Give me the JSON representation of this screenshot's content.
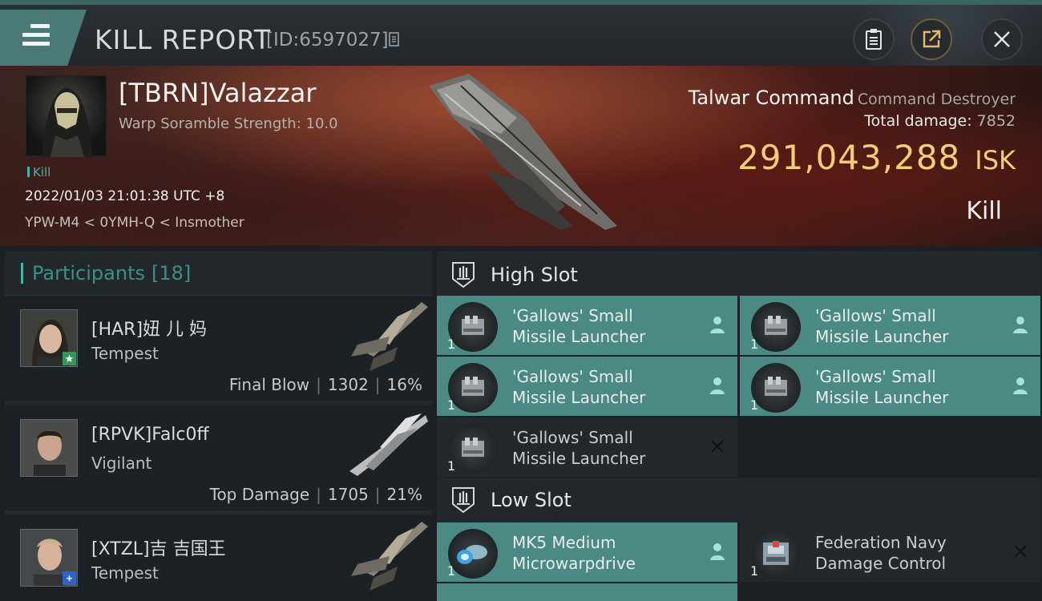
{
  "header": {
    "title": "KILL REPORT",
    "report_id": "[ID:6597027]"
  },
  "victim": {
    "name": "[TBRN]Valazzar",
    "scramble": "Warp Soramble Strength: 10.0",
    "tag": "Kill",
    "datetime": "2022/01/03 21:01:38 UTC +8",
    "location": "YPW-M4 < 0YMH-Q < Insmother",
    "ship_name": "Talwar Command",
    "ship_class": "Command Destroyer",
    "damage_label": "Total damage:",
    "damage_value": "7852",
    "isk_value": "291,043,288",
    "isk_unit": "ISK",
    "result": "Kill"
  },
  "participants": {
    "title": "Participants",
    "count": "[18]",
    "items": [
      {
        "name": "[HAR]妞 儿 妈",
        "ship": "Tempest",
        "role": "Final Blow",
        "damage": "1302",
        "pct": "16%",
        "badge": "★"
      },
      {
        "name": "[RPVK]Falc0ff",
        "ship": "Vigilant",
        "role": "Top Damage",
        "damage": "1705",
        "pct": "21%",
        "badge": ""
      },
      {
        "name": "[XTZL]吉 吉国王",
        "ship": "Tempest",
        "role": "",
        "damage": "",
        "pct": "",
        "badge": "+"
      }
    ]
  },
  "slots": {
    "high": {
      "title": "High Slot",
      "modules": [
        {
          "line1": "'Gallows' Small",
          "line2": "Missile Launcher",
          "qty": "1",
          "status": "dropped"
        },
        {
          "line1": "'Gallows' Small",
          "line2": "Missile Launcher",
          "qty": "1",
          "status": "dropped"
        },
        {
          "line1": "'Gallows' Small",
          "line2": "Missile Launcher",
          "qty": "1",
          "status": "dropped"
        },
        {
          "line1": "'Gallows' Small",
          "line2": "Missile Launcher",
          "qty": "1",
          "status": "dropped"
        },
        {
          "line1": "'Gallows' Small",
          "line2": "Missile Launcher",
          "qty": "1",
          "status": "destroyed"
        }
      ]
    },
    "low": {
      "title": "Low Slot",
      "modules": [
        {
          "line1": "MK5 Medium",
          "line2": "Microwarpdrive",
          "qty": "1",
          "status": "dropped"
        },
        {
          "line1": "Federation Navy",
          "line2": "Damage Control",
          "qty": "1",
          "status": "destroyed"
        }
      ]
    }
  },
  "colors": {
    "accent_teal": "#4ab3a8",
    "dropped_bg": "#4b8a84",
    "isk_gold": "#f1cf78"
  }
}
